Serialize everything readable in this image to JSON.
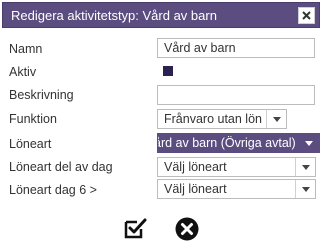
{
  "dialog": {
    "title": "Redigera aktivitetstyp: Vård av barn"
  },
  "form": {
    "namn": {
      "label": "Namn",
      "value": "Vård av barn"
    },
    "aktiv": {
      "label": "Aktiv",
      "checked": true
    },
    "beskrivning": {
      "label": "Beskrivning",
      "value": ""
    },
    "funktion": {
      "label": "Funktion",
      "value": "Frånvaro utan lön"
    },
    "loneart": {
      "label": "Löneart",
      "value": "ård av barn (Övriga avtal)"
    },
    "loneart_del": {
      "label": "Löneart del av dag",
      "value": "Välj löneart"
    },
    "loneart_dag6": {
      "label": "Löneart dag 6 >",
      "value": "Välj löneart"
    }
  },
  "footer": {
    "save_icon": "check-box-icon",
    "cancel_icon": "close-circle-icon"
  },
  "colors": {
    "accent": "#5c4d80",
    "checkbox_fill": "#2b2252"
  }
}
